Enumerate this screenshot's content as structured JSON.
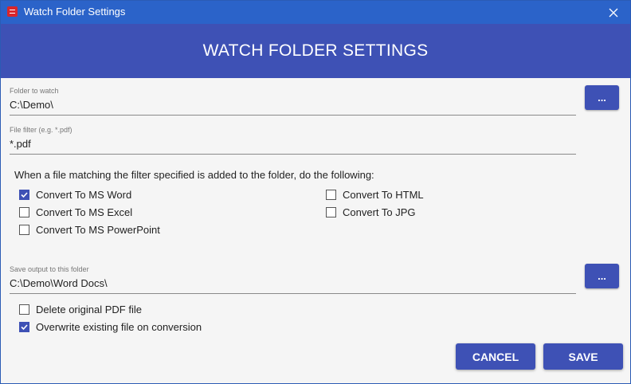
{
  "window": {
    "title": "Watch Folder Settings"
  },
  "header": {
    "title": "WATCH FOLDER SETTINGS"
  },
  "folder": {
    "label": "Folder to watch",
    "value": "C:\\Demo\\",
    "browse_label": "..."
  },
  "filter": {
    "label": "File filter (e.g. *.pdf)",
    "value": "*.pdf"
  },
  "instruction": "When a file matching the filter specified is added to the folder, do the following:",
  "options": {
    "word": {
      "label": "Convert To MS Word",
      "checked": true
    },
    "excel": {
      "label": "Convert To MS Excel",
      "checked": false
    },
    "powerpoint": {
      "label": "Convert To MS PowerPoint",
      "checked": false
    },
    "html": {
      "label": "Convert To HTML",
      "checked": false
    },
    "jpg": {
      "label": "Convert To JPG",
      "checked": false
    }
  },
  "output": {
    "label": "Save output to this folder",
    "value": "C:\\Demo\\Word Docs\\",
    "browse_label": "..."
  },
  "post": {
    "delete": {
      "label": "Delete original PDF file",
      "checked": false
    },
    "overwrite": {
      "label": "Overwrite existing file on conversion",
      "checked": true
    }
  },
  "buttons": {
    "cancel": "CANCEL",
    "save": "SAVE"
  },
  "colors": {
    "titlebar": "#2b63c9",
    "accent": "#3e51b5",
    "background": "#f5f5f5"
  }
}
